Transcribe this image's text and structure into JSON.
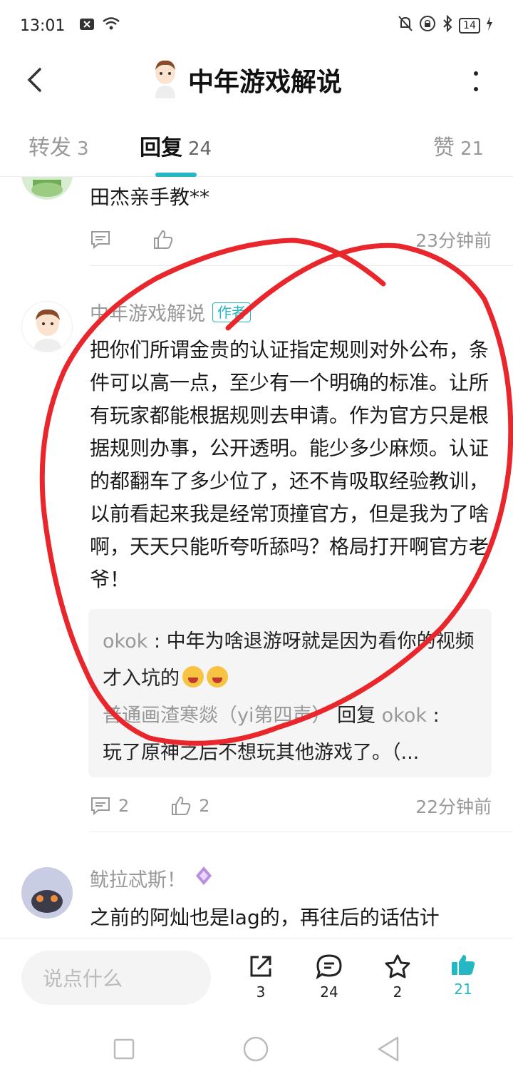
{
  "status_bar": {
    "time": "13:01",
    "battery": "14"
  },
  "header": {
    "title": "中年游戏解说"
  },
  "tabs": [
    {
      "label": "转发",
      "count": "3"
    },
    {
      "label": "回复",
      "count": "24"
    },
    {
      "label": "赞",
      "count": "21"
    }
  ],
  "comments": [
    {
      "text": "田杰亲手教**",
      "time": "23分钟前"
    },
    {
      "username": "中年游戏解说",
      "badge": "作者",
      "text": "把你们所谓金贵的认证指定规则对外公布，条件可以高一点，至少有一个明确的标准。让所有玩家都能根据规则去申请。作为官方只是根据规则办事，公开透明。能少多少麻烦。认证的都翻车了多少位了，还不肯吸取经验教训，以前看起来我是经常顶撞官方，但是我为了啥啊，天天只能听夸听舔吗？格局打开啊官方老爷！",
      "replies": [
        {
          "user": "okok",
          "sep": " : ",
          "text": "中年为啥退游呀就是因为看你的视频才入坑的"
        },
        {
          "user": "普通画渣寒燚（yi第四声）",
          "mid": " 回复 ",
          "target": "okok",
          "sep": " : ",
          "text": "玩了原神之后不想玩其他游戏了。（..."
        }
      ],
      "reply_count": "2",
      "like_count": "2",
      "time": "22分钟前"
    },
    {
      "username": "鱿拉忒斯！",
      "text": "之前的阿灿也是lag的，再往后的话估计"
    }
  ],
  "bottom_bar": {
    "input_placeholder": "说点什么",
    "share_count": "3",
    "comment_count": "24",
    "favorite_count": "2",
    "like_count": "21"
  },
  "colors": {
    "accent": "#25b7c4",
    "annotation": "#e8262c"
  }
}
